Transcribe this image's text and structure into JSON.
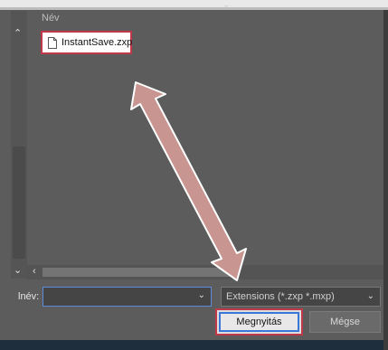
{
  "file_list": {
    "column_header": "Név",
    "items": [
      {
        "name": "InstantSave.zxp",
        "icon": "document-icon"
      }
    ]
  },
  "filename": {
    "label": "lnév:",
    "value": ""
  },
  "filter": {
    "selected": "Extensions (*.zxp *.mxp)"
  },
  "buttons": {
    "open": "Megnyitás",
    "cancel": "Mégse"
  },
  "colors": {
    "highlight_border": "#c0394a",
    "focus_border": "#3a78d8",
    "arrow_fill": "#c89590"
  }
}
